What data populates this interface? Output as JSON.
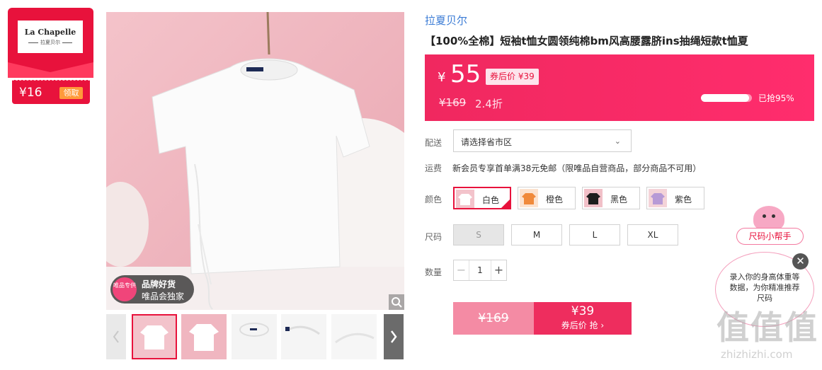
{
  "store": {
    "logo_name": "La Chapelle",
    "logo_sub": "拉夏贝尔",
    "coupon_amount": "¥16",
    "coupon_button": "领取"
  },
  "gallery": {
    "promo_badge": "唯品专供",
    "promo_line1": "品牌好货",
    "promo_line2": "唯品会独家",
    "zoom_icon": "magnifier-icon",
    "prev_icon": "chevron-left-icon",
    "next_icon": "chevron-right-icon",
    "next_glyph": "›",
    "thumbnail_count": 5,
    "selected_thumbnail": 1
  },
  "product": {
    "brand": "拉夏贝尔",
    "title": "【100%全棉】短袖t恤女圆领纯棉bm风高腰露脐ins抽绳短款t恤夏"
  },
  "price": {
    "currency": "¥",
    "value": "55",
    "after_coupon": "券后价 ¥39",
    "original": "¥169",
    "discount": "2.4折",
    "sold_percent": 0.95,
    "sold_text": "已抢95%"
  },
  "delivery": {
    "label": "配送",
    "select_text": "请选择省市区",
    "chevron": "⌄"
  },
  "shipping": {
    "label": "运费",
    "text": "新会员专享首单满38元免邮（限唯品自营商品，部分商品不可用）"
  },
  "colors": {
    "label": "颜色",
    "options": [
      {
        "name": "白色",
        "swatch": "#ffffff",
        "selected": true
      },
      {
        "name": "橙色",
        "swatch": "#f08a3c",
        "selected": false
      },
      {
        "name": "黑色",
        "swatch": "#1e1e1e",
        "selected": false
      },
      {
        "name": "紫色",
        "swatch": "#b79ad6",
        "selected": false
      }
    ]
  },
  "sizes": {
    "label": "尺码",
    "options": [
      {
        "name": "S",
        "disabled": true
      },
      {
        "name": "M",
        "disabled": false
      },
      {
        "name": "L",
        "disabled": false
      },
      {
        "name": "XL",
        "disabled": false
      }
    ]
  },
  "quantity": {
    "label": "数量",
    "value": "1",
    "minus": "−",
    "plus": "+"
  },
  "buy": {
    "original": "¥169",
    "price": "¥39",
    "sub": "券后价 抢 ›"
  },
  "helper": {
    "label": "尺码小帮手",
    "text": "录入你的身高体重等数据，为你精准推荐尺码",
    "close": "✕"
  },
  "watermark": {
    "big": "值值值",
    "small": "zhizhizhi.com"
  },
  "colors_theme": {
    "accent": "#e8123c",
    "price_bg": "#f0285f",
    "link": "#3a7bd5"
  }
}
